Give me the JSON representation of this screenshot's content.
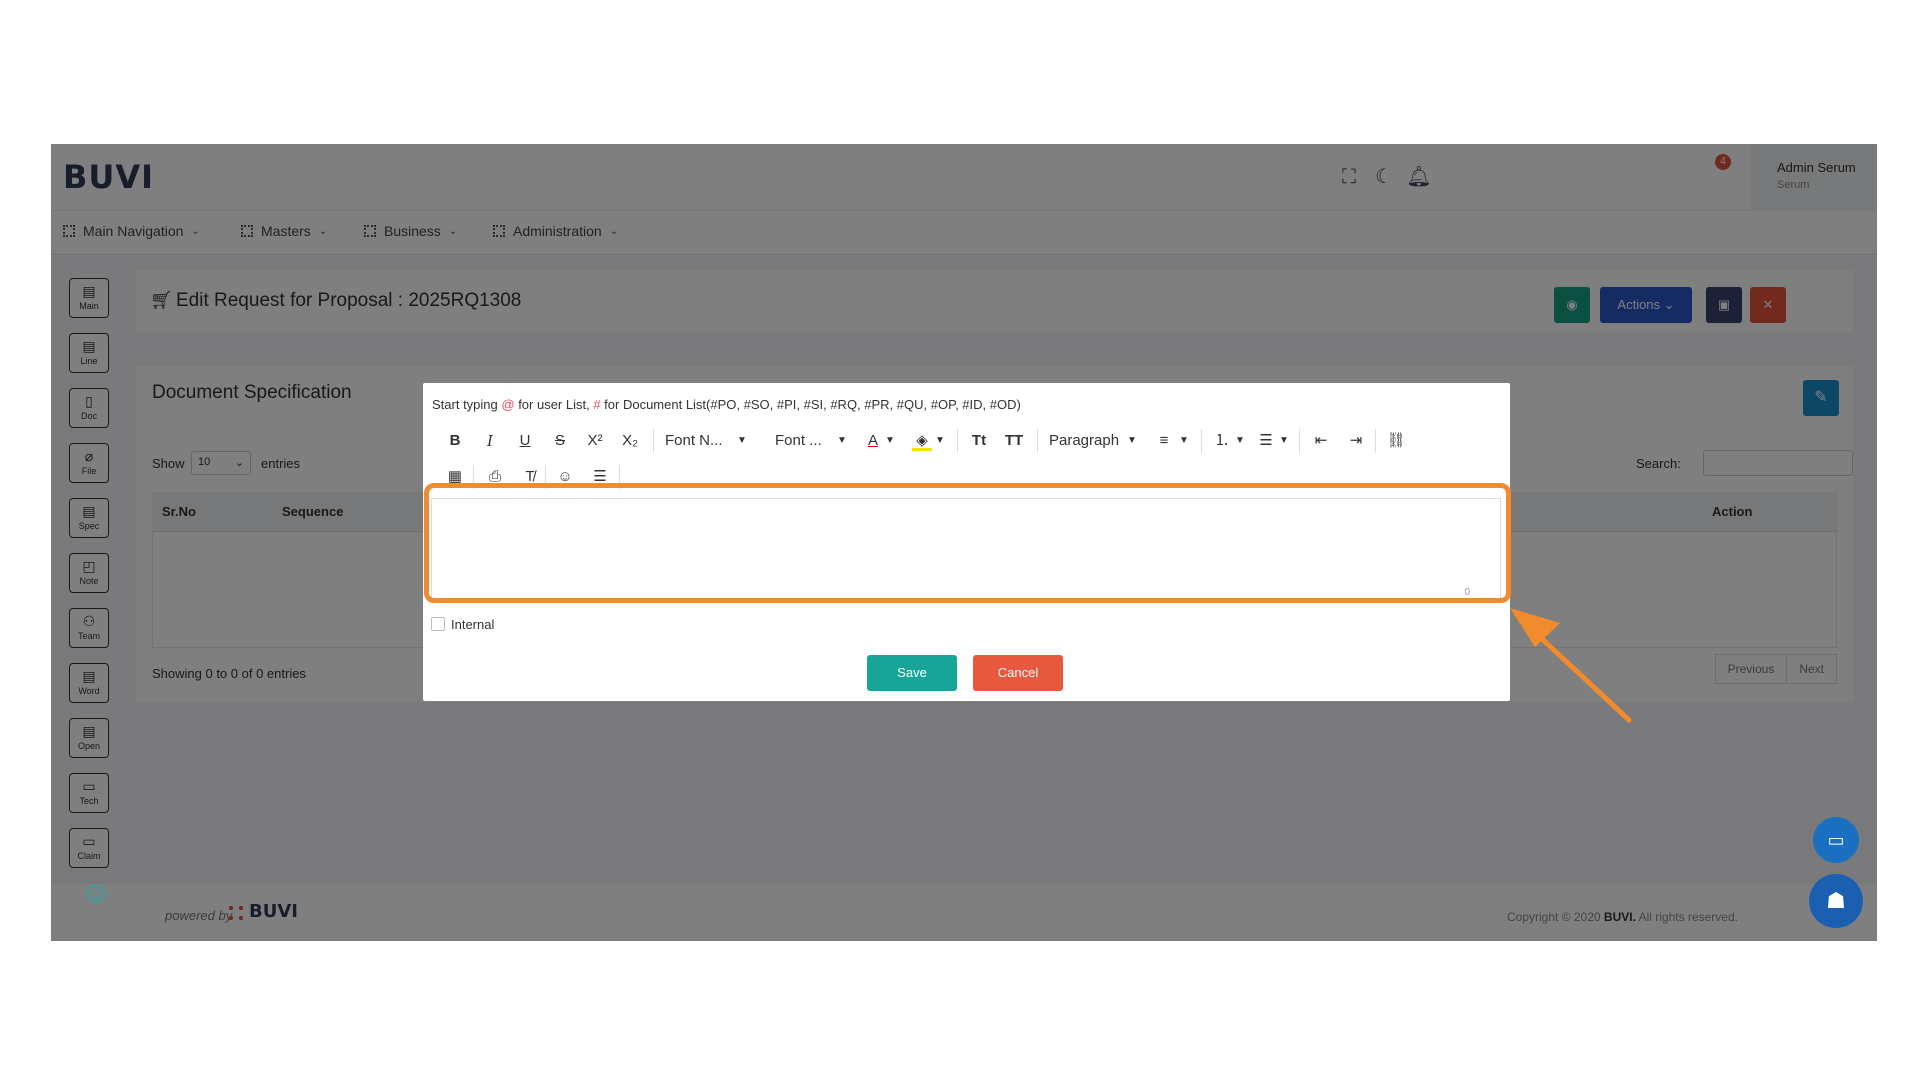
{
  "brand": {
    "logo": "BUVI"
  },
  "header": {
    "notification_count": "4",
    "user_name": "Admin Serum",
    "user_sub": "Serum",
    "icons": [
      "fullscreen-icon",
      "moon-icon",
      "bell-icon"
    ]
  },
  "nav": {
    "items": [
      {
        "label": "Main Navigation"
      },
      {
        "label": "Masters"
      },
      {
        "label": "Business"
      },
      {
        "label": "Administration"
      }
    ]
  },
  "sidebar": {
    "items": [
      {
        "label": "Main"
      },
      {
        "label": "Line"
      },
      {
        "label": "Doc"
      },
      {
        "label": "File"
      },
      {
        "label": "Spec"
      },
      {
        "label": "Note"
      },
      {
        "label": "Team"
      },
      {
        "label": "Word"
      },
      {
        "label": "Open"
      },
      {
        "label": "Tech"
      },
      {
        "label": "Claim"
      }
    ]
  },
  "page": {
    "title": "Edit Request for Proposal : 2025RQ1308",
    "actions_label": "Actions",
    "colors": {
      "view": "#16a085",
      "actions": "#2a56c6",
      "save": "#3a4270",
      "close": "#e2553b"
    }
  },
  "card": {
    "title": "Document Specification",
    "show_label": "Show",
    "show_value": "10",
    "entries_label": "entries",
    "search_label": "Search:",
    "columns": [
      "Sr.No",
      "Sequence",
      "Action"
    ],
    "showing": "Showing 0 to 0 of 0 entries",
    "pager": [
      "Previous",
      "Next"
    ]
  },
  "footer": {
    "powered_by": "powered by",
    "brand": "BUVI",
    "copyright_prefix": "Copyright © 2020 ",
    "copyright_brand": "BUVI.",
    "copyright_suffix": " All rights reserved."
  },
  "modal": {
    "hint_part1": "Start typing ",
    "hint_at": "@",
    "hint_part2": " for user List, ",
    "hint_hash": "#",
    "hint_part3": " for Document List(#PO, #SO, #PI, #SI, #RQ, #PR, #QU, #OP, #ID, #OD)",
    "toolbar": {
      "font_name": "Font N...",
      "font_size": "Font ...",
      "paragraph": "Paragraph"
    },
    "editor_count": "0",
    "internal_label": "Internal",
    "save_label": "Save",
    "cancel_label": "Cancel",
    "colors": {
      "save": "#16a596",
      "cancel": "#e8583f",
      "highlight": "#f28a2e"
    }
  }
}
